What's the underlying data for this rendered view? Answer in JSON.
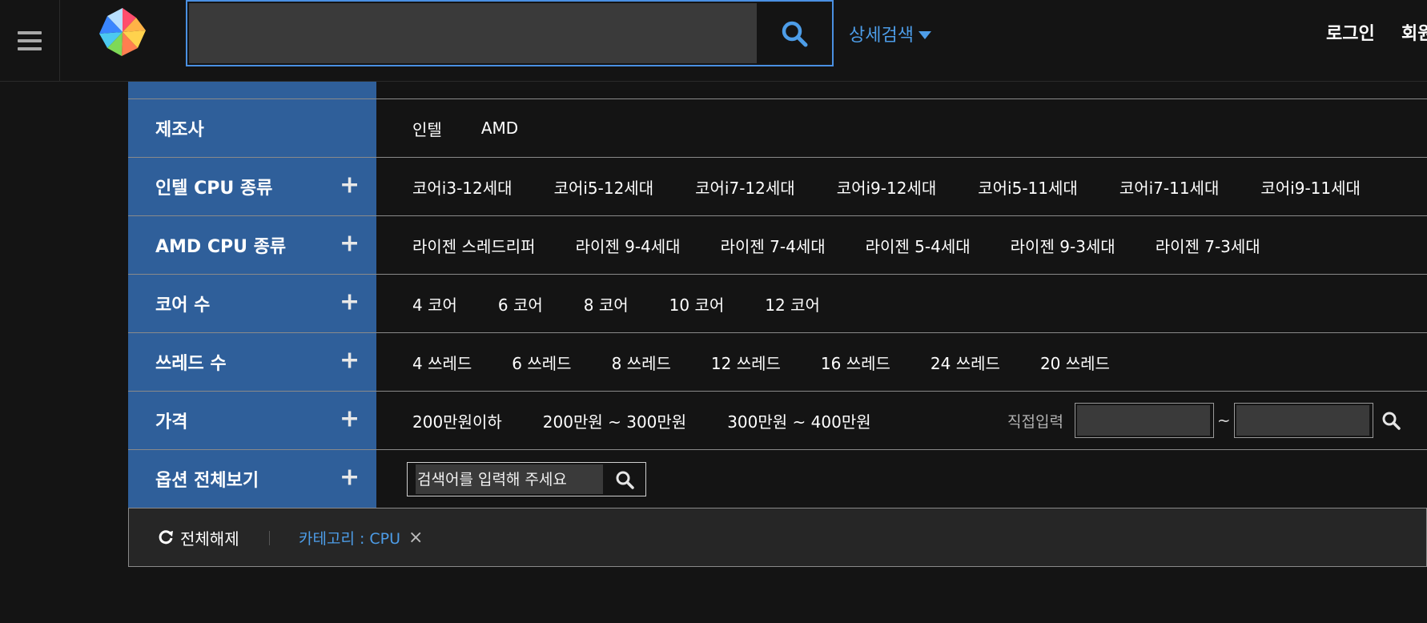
{
  "header": {
    "search_value": "",
    "advanced_search_label": "상세검색",
    "login_label": "로그인",
    "join_label": "회원"
  },
  "filters": {
    "manufacturer": {
      "label": "제조사",
      "options": [
        "인텔",
        "AMD"
      ]
    },
    "intel_cpu_type": {
      "label": "인텔 CPU 종류",
      "options": [
        "코어i3-12세대",
        "코어i5-12세대",
        "코어i7-12세대",
        "코어i9-12세대",
        "코어i5-11세대",
        "코어i7-11세대",
        "코어i9-11세대"
      ]
    },
    "amd_cpu_type": {
      "label": "AMD CPU 종류",
      "options": [
        "라이젠 스레드리퍼",
        "라이젠 9-4세대",
        "라이젠 7-4세대",
        "라이젠 5-4세대",
        "라이젠 9-3세대",
        "라이젠 7-3세대"
      ]
    },
    "core_count": {
      "label": "코어 수",
      "options": [
        "4 코어",
        "6 코어",
        "8 코어",
        "10 코어",
        "12 코어"
      ]
    },
    "thread_count": {
      "label": "쓰레드 수",
      "options": [
        "4 쓰레드",
        "6 쓰레드",
        "8 쓰레드",
        "12 쓰레드",
        "16 쓰레드",
        "24 쓰레드",
        "20 쓰레드"
      ]
    },
    "price": {
      "label": "가격",
      "options": [
        "200만원이하",
        "200만원 ~ 300만원",
        "300만원 ~ 400만원"
      ],
      "direct_input_label": "직접입력",
      "min_value": "",
      "max_value": "",
      "range_separator": "~"
    },
    "all_options": {
      "label": "옵션 전체보기",
      "search_placeholder": "검색어를 입력해 주세요"
    },
    "plus_symbol": "+"
  },
  "summary": {
    "reset_label": "전체해제",
    "selected_chip": "카테고리 : CPU",
    "chip_remove": "×"
  },
  "colors": {
    "background": "#141414",
    "header_cell": "#2f5f9a",
    "accent": "#4d9de8",
    "summary_bar": "#262626"
  }
}
